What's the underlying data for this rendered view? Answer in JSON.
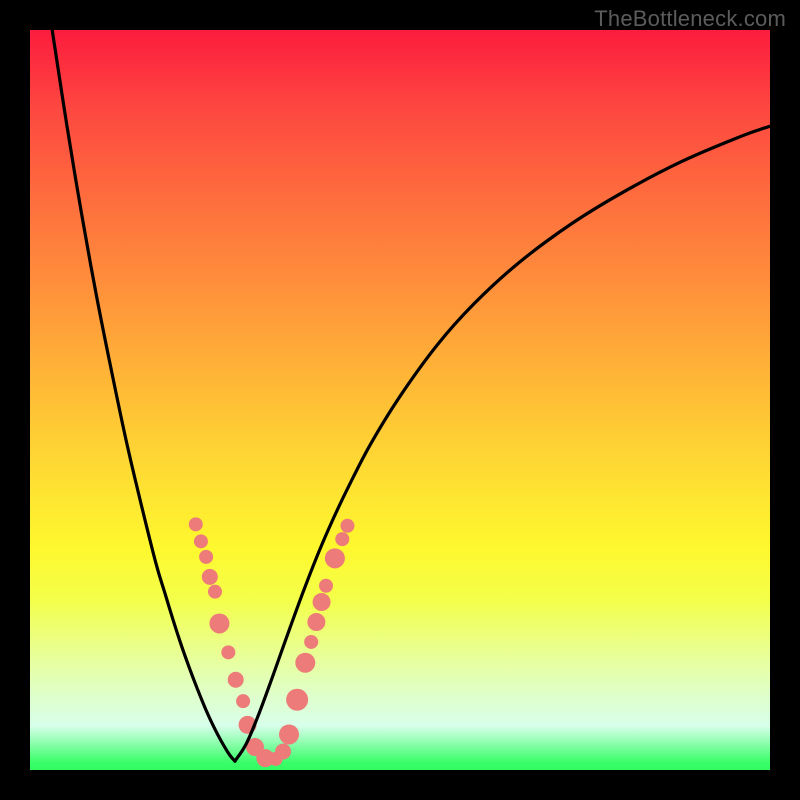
{
  "watermark": "TheBottleneck.com",
  "chart_data": {
    "type": "line",
    "title": "",
    "xlabel": "",
    "ylabel": "",
    "xlim": [
      0,
      100
    ],
    "ylim": [
      0,
      100
    ],
    "grid": false,
    "series": [
      {
        "name": "curve-left",
        "x": [
          3,
          5,
          7,
          9,
          11,
          13,
          15,
          17,
          18.2,
          19.3,
          20.4,
          21.5,
          22.6,
          23.7,
          24.8,
          25.9,
          27,
          27.7
        ],
        "values": [
          100,
          87,
          75,
          64,
          54,
          44.5,
          36,
          28,
          24,
          20.4,
          17,
          13.9,
          11,
          8.3,
          5.9,
          3.8,
          2,
          1.2
        ]
      },
      {
        "name": "curve-right",
        "x": [
          27.7,
          29.2,
          30.7,
          32.2,
          33.7,
          35.2,
          37,
          39,
          41,
          43,
          46,
          50,
          55,
          60,
          66,
          73,
          80,
          88,
          96,
          100
        ],
        "values": [
          1.2,
          3.5,
          7,
          11,
          15.2,
          19.4,
          24.3,
          29.4,
          34,
          38.2,
          44,
          50.5,
          57.4,
          63,
          68.5,
          73.7,
          78,
          82.2,
          85.6,
          87
        ]
      }
    ],
    "markers": {
      "name": "highlight-dots",
      "color": "#ed7b79",
      "points": [
        {
          "x": 22.4,
          "y": 33.2,
          "r": 7
        },
        {
          "x": 23.1,
          "y": 30.9,
          "r": 7
        },
        {
          "x": 23.8,
          "y": 28.8,
          "r": 7
        },
        {
          "x": 24.3,
          "y": 26.1,
          "r": 8
        },
        {
          "x": 25.0,
          "y": 24.1,
          "r": 7
        },
        {
          "x": 25.6,
          "y": 19.8,
          "r": 10
        },
        {
          "x": 26.8,
          "y": 15.9,
          "r": 7
        },
        {
          "x": 27.8,
          "y": 12.2,
          "r": 8
        },
        {
          "x": 28.8,
          "y": 9.3,
          "r": 7
        },
        {
          "x": 29.4,
          "y": 6.1,
          "r": 9
        },
        {
          "x": 30.4,
          "y": 3.1,
          "r": 9
        },
        {
          "x": 31.8,
          "y": 1.6,
          "r": 9
        },
        {
          "x": 33.2,
          "y": 1.5,
          "r": 7
        },
        {
          "x": 34.2,
          "y": 2.5,
          "r": 8
        },
        {
          "x": 35.0,
          "y": 4.8,
          "r": 10
        },
        {
          "x": 36.1,
          "y": 9.5,
          "r": 11
        },
        {
          "x": 37.2,
          "y": 14.5,
          "r": 10
        },
        {
          "x": 38.0,
          "y": 17.3,
          "r": 7
        },
        {
          "x": 38.7,
          "y": 20.0,
          "r": 9
        },
        {
          "x": 39.4,
          "y": 22.7,
          "r": 9
        },
        {
          "x": 40.0,
          "y": 24.9,
          "r": 7
        },
        {
          "x": 41.2,
          "y": 28.6,
          "r": 10
        },
        {
          "x": 42.2,
          "y": 31.2,
          "r": 7
        },
        {
          "x": 42.9,
          "y": 33.0,
          "r": 7
        }
      ]
    }
  }
}
